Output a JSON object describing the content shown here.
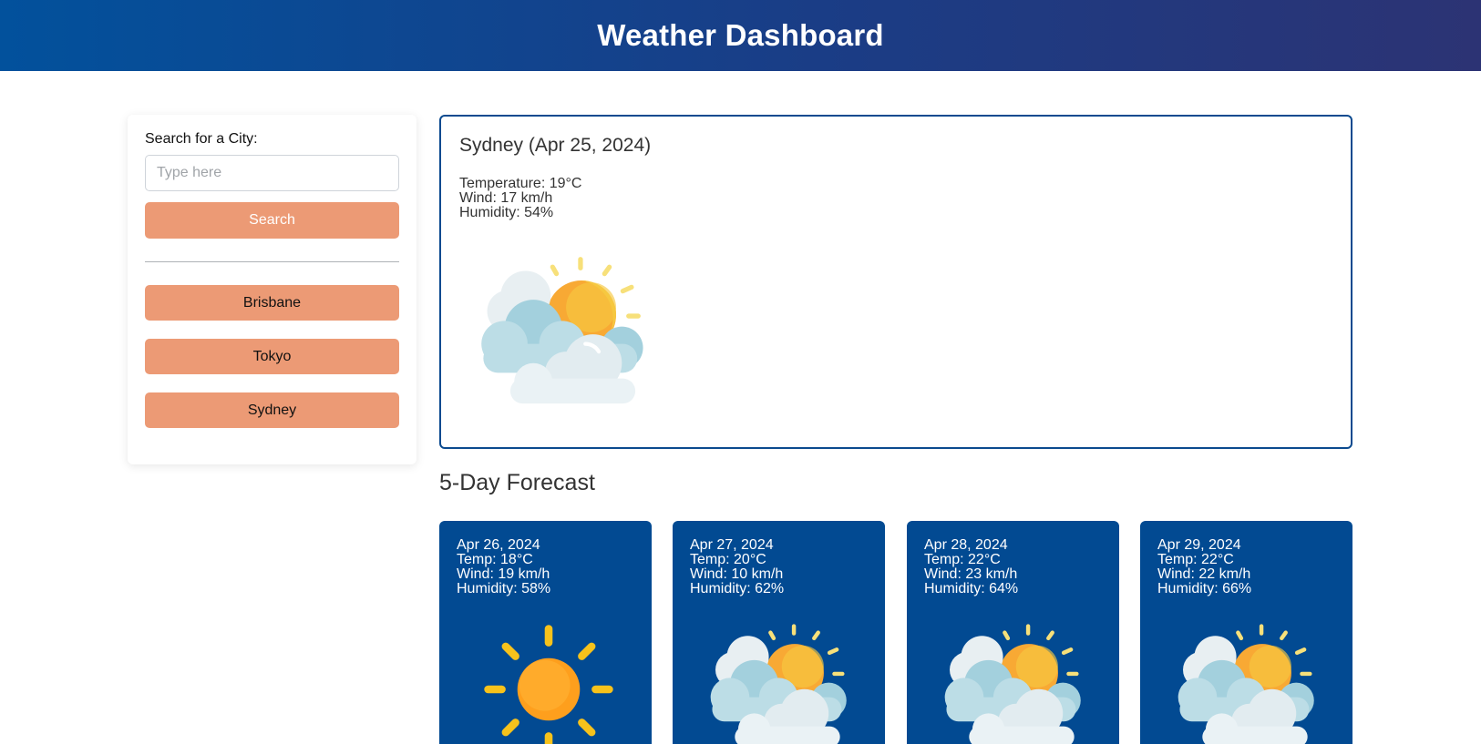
{
  "header": {
    "title": "Weather Dashboard"
  },
  "sidebar": {
    "search_label": "Search for a City:",
    "search_placeholder": "Type here",
    "search_value": "",
    "search_button": "Search",
    "history": [
      {
        "label": "Brisbane"
      },
      {
        "label": "Tokyo"
      },
      {
        "label": "Sydney"
      }
    ]
  },
  "current": {
    "title": "Sydney (Apr 25, 2024)",
    "temperature": "Temperature: 19°C",
    "wind": "Wind: 17 km/h",
    "humidity": "Humidity: 54%",
    "icon": "partly-cloudy-icon"
  },
  "forecast": {
    "title": "5-Day Forecast",
    "days": [
      {
        "date": "Apr 26, 2024",
        "temp": "Temp: 18°C",
        "wind": "Wind: 19 km/h",
        "humidity": "Humidity: 58%",
        "icon": "sun-icon"
      },
      {
        "date": "Apr 27, 2024",
        "temp": "Temp: 20°C",
        "wind": "Wind: 10 km/h",
        "humidity": "Humidity: 62%",
        "icon": "partly-cloudy-icon"
      },
      {
        "date": "Apr 28, 2024",
        "temp": "Temp: 22°C",
        "wind": "Wind: 23 km/h",
        "humidity": "Humidity: 64%",
        "icon": "partly-cloudy-icon"
      },
      {
        "date": "Apr 29, 2024",
        "temp": "Temp: 22°C",
        "wind": "Wind: 22 km/h",
        "humidity": "Humidity: 66%",
        "icon": "partly-cloudy-icon"
      }
    ]
  },
  "colors": {
    "header_start": "#02519c",
    "header_end": "#2c3374",
    "button": "#ec9a75",
    "card": "#024a92",
    "current_border": "#0b4a8f"
  }
}
